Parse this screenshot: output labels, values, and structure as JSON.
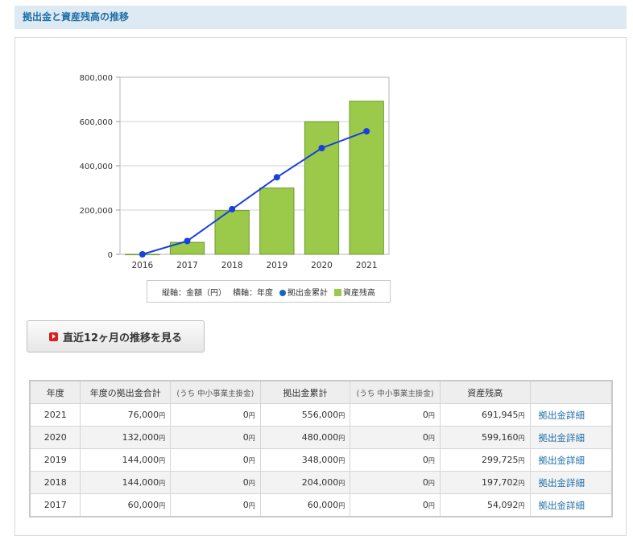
{
  "section": {
    "title": "拠出金と資産残高の推移"
  },
  "chart_data": {
    "type": "bar",
    "categories": [
      "2016",
      "2017",
      "2018",
      "2019",
      "2020",
      "2021"
    ],
    "series": [
      {
        "name": "資産残高",
        "type": "bar",
        "color": "#9bc94a",
        "values": [
          0,
          54092,
          197702,
          299725,
          599160,
          691945
        ]
      },
      {
        "name": "拠出金累計",
        "type": "line",
        "color": "#1a3fe0",
        "values": [
          0,
          60000,
          204000,
          348000,
          480000,
          556000
        ]
      }
    ],
    "ylim": [
      0,
      800000
    ],
    "yticks": [
      "0",
      "200,000",
      "400,000",
      "600,000",
      "800,000"
    ],
    "ytick_values": [
      0,
      200000,
      400000,
      600000,
      800000
    ],
    "grid": true,
    "legend_position": "bottom"
  },
  "legend": {
    "vertical_axis": "縦軸：金額（円）",
    "horizontal_axis": "横軸：年度",
    "line_label": "拠出金累計",
    "bar_label": "資産残高"
  },
  "trend_button": {
    "label": "直近12ヶ月の推移を見る"
  },
  "table": {
    "headers": [
      "年度",
      "年度の拠出金合計",
      "(うち 中小事業主掛金)",
      "拠出金累計",
      "(うち 中小事業主掛金)",
      "資産残高",
      ""
    ],
    "yen": "円",
    "rows": [
      {
        "year": "2021",
        "annual": "76,000",
        "annual_sme": "0",
        "cumulative": "556,000",
        "cumulative_sme": "0",
        "balance": "691,945",
        "link": "拠出金詳細"
      },
      {
        "year": "2020",
        "annual": "132,000",
        "annual_sme": "0",
        "cumulative": "480,000",
        "cumulative_sme": "0",
        "balance": "599,160",
        "link": "拠出金詳細"
      },
      {
        "year": "2019",
        "annual": "144,000",
        "annual_sme": "0",
        "cumulative": "348,000",
        "cumulative_sme": "0",
        "balance": "299,725",
        "link": "拠出金詳細"
      },
      {
        "year": "2018",
        "annual": "144,000",
        "annual_sme": "0",
        "cumulative": "204,000",
        "cumulative_sme": "0",
        "balance": "197,702",
        "link": "拠出金詳細"
      },
      {
        "year": "2017",
        "annual": "60,000",
        "annual_sme": "0",
        "cumulative": "60,000",
        "cumulative_sme": "0",
        "balance": "54,092",
        "link": "拠出金詳細"
      }
    ]
  }
}
